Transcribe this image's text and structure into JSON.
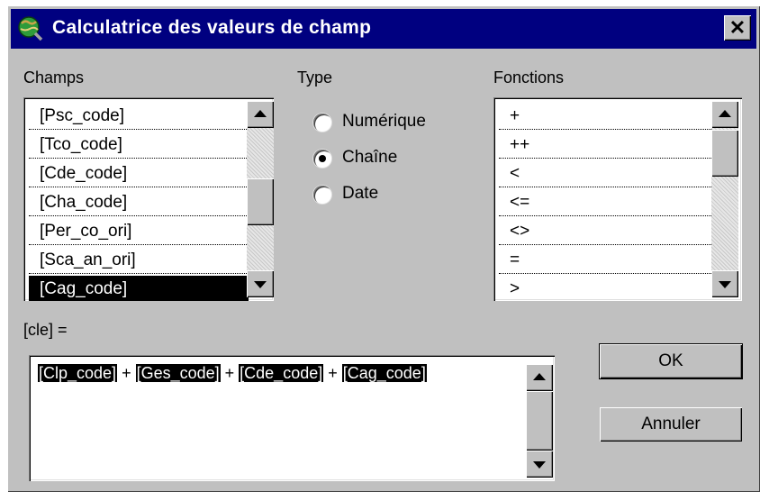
{
  "window": {
    "title": "Calculatrice des valeurs de champ",
    "close_label": "✕"
  },
  "champs": {
    "label": "Champs",
    "items": [
      "[Psc_code]",
      "[Tco_code]",
      "[Cde_code]",
      "[Cha_code]",
      "[Per_co_ori]",
      "[Sca_an_ori]",
      "[Cag_code]"
    ],
    "selected": "[Cag_code]"
  },
  "type": {
    "label": "Type",
    "options": [
      "Numérique",
      "Chaîne",
      "Date"
    ],
    "selected": "Chaîne"
  },
  "fonctions": {
    "label": "Fonctions",
    "items": [
      "+",
      "++",
      "<",
      "<=",
      "<>",
      "=",
      ">"
    ]
  },
  "expression": {
    "label": "[cle] =",
    "tokens": [
      "[Clp_code]",
      "+",
      "[Ges_code]",
      "+",
      "[Cde_code]",
      "+",
      "[Cag_code]"
    ]
  },
  "buttons": {
    "ok": "OK",
    "cancel": "Annuler"
  }
}
